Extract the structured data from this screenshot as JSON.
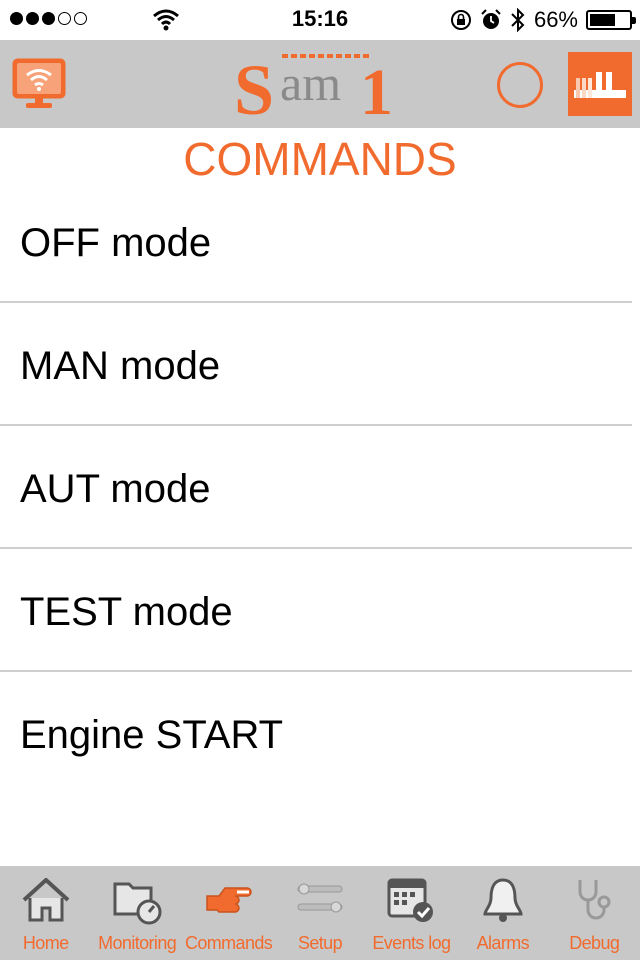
{
  "status_bar": {
    "time": "15:16",
    "battery_percent": "66%",
    "battery_level": 0.66,
    "signal_bars_filled": 3,
    "signal_bars_total": 5
  },
  "header": {
    "logo_text": "Sam1",
    "accent_color": "#f26b2e",
    "header_bg": "#c8c8c8"
  },
  "page": {
    "title": "COMMANDS"
  },
  "commands": [
    {
      "label": "OFF mode"
    },
    {
      "label": "MAN mode"
    },
    {
      "label": "AUT mode"
    },
    {
      "label": "TEST mode"
    },
    {
      "label": "Engine START"
    }
  ],
  "tabs": [
    {
      "label": "Home",
      "icon": "home-icon",
      "active": false
    },
    {
      "label": "Monitoring",
      "icon": "monitoring-icon",
      "active": false
    },
    {
      "label": "Commands",
      "icon": "pointing-hand-icon",
      "active": true
    },
    {
      "label": "Setup",
      "icon": "wrench-icon",
      "active": false
    },
    {
      "label": "Events log",
      "icon": "calendar-icon",
      "active": false
    },
    {
      "label": "Alarms",
      "icon": "bell-icon",
      "active": false
    },
    {
      "label": "Debug",
      "icon": "stethoscope-icon",
      "active": false
    }
  ]
}
